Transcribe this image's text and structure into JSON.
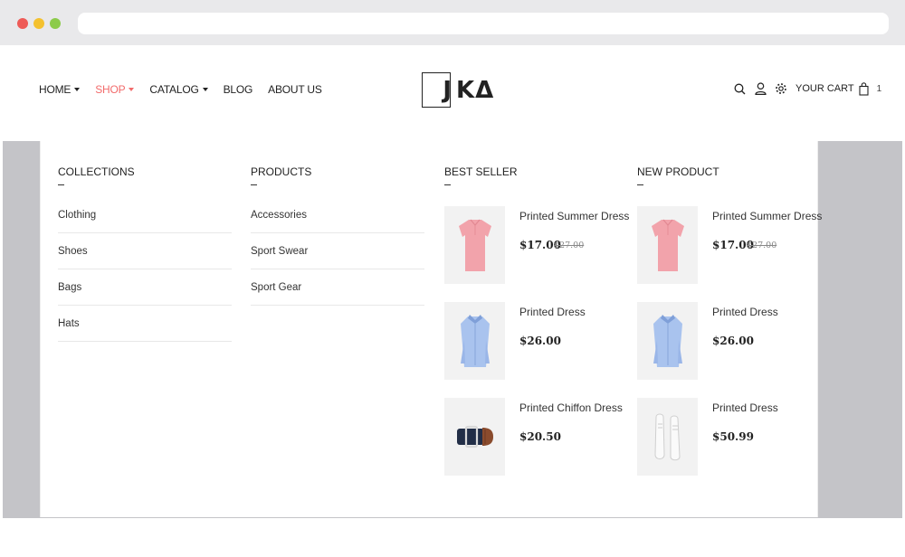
{
  "nav": {
    "home": "HOME",
    "shop": "SHOP",
    "catalog": "CATALOG",
    "blog": "BLOG",
    "about": "ABOUT US",
    "active_color": "#f26b6b"
  },
  "logo": {
    "j": "J",
    "rest": "KΔ"
  },
  "header": {
    "cart_label": "YOUR CART",
    "cart_count": "1"
  },
  "menu": {
    "collections": {
      "title": "COLLECTIONS",
      "items": [
        "Clothing",
        "Shoes",
        "Bags",
        "Hats"
      ]
    },
    "products": {
      "title": "PRODUCTS",
      "items": [
        "Accessories",
        "Sport Swear",
        "Sport Gear"
      ]
    },
    "best_seller": {
      "title": "BEST SELLER",
      "items": [
        {
          "name": "Printed Summer Dress",
          "price": "$17.00",
          "old_price": "$27.00",
          "image": "pink-shirt"
        },
        {
          "name": "Printed Dress",
          "price": "$26.00",
          "image": "blue-shirt"
        },
        {
          "name": "Printed Chiffon Dress",
          "price": "$20.50",
          "image": "belt"
        }
      ]
    },
    "new_product": {
      "title": "NEW PRODUCT",
      "items": [
        {
          "name": "Printed Summer Dress",
          "price": "$17.00",
          "old_price": "$27.00",
          "image": "pink-shirt"
        },
        {
          "name": "Printed Dress",
          "price": "$26.00",
          "image": "blue-shirt"
        },
        {
          "name": "Printed Dress",
          "price": "$50.99",
          "image": "white-sneakers"
        }
      ]
    }
  }
}
